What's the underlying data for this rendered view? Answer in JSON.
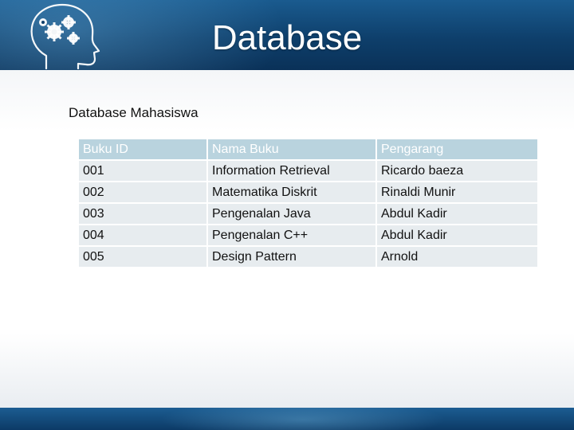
{
  "slide": {
    "title": "Database",
    "subtitle": "Database Mahasiswa"
  },
  "icons": {
    "banner": "head-with-gears-icon"
  },
  "colors": {
    "banner": "#0e3f6b",
    "table_header": "#b9d3de",
    "table_row": "#e7ecef"
  },
  "table": {
    "headers": [
      "Buku ID",
      "Nama Buku",
      "Pengarang"
    ],
    "rows": [
      [
        "001",
        "Information Retrieval",
        "Ricardo baeza"
      ],
      [
        "002",
        "Matematika Diskrit",
        "Rinaldi Munir"
      ],
      [
        "003",
        "Pengenalan Java",
        "Abdul Kadir"
      ],
      [
        "004",
        "Pengenalan C++",
        "Abdul Kadir"
      ],
      [
        "005",
        "Design Pattern",
        "Arnold"
      ]
    ]
  }
}
